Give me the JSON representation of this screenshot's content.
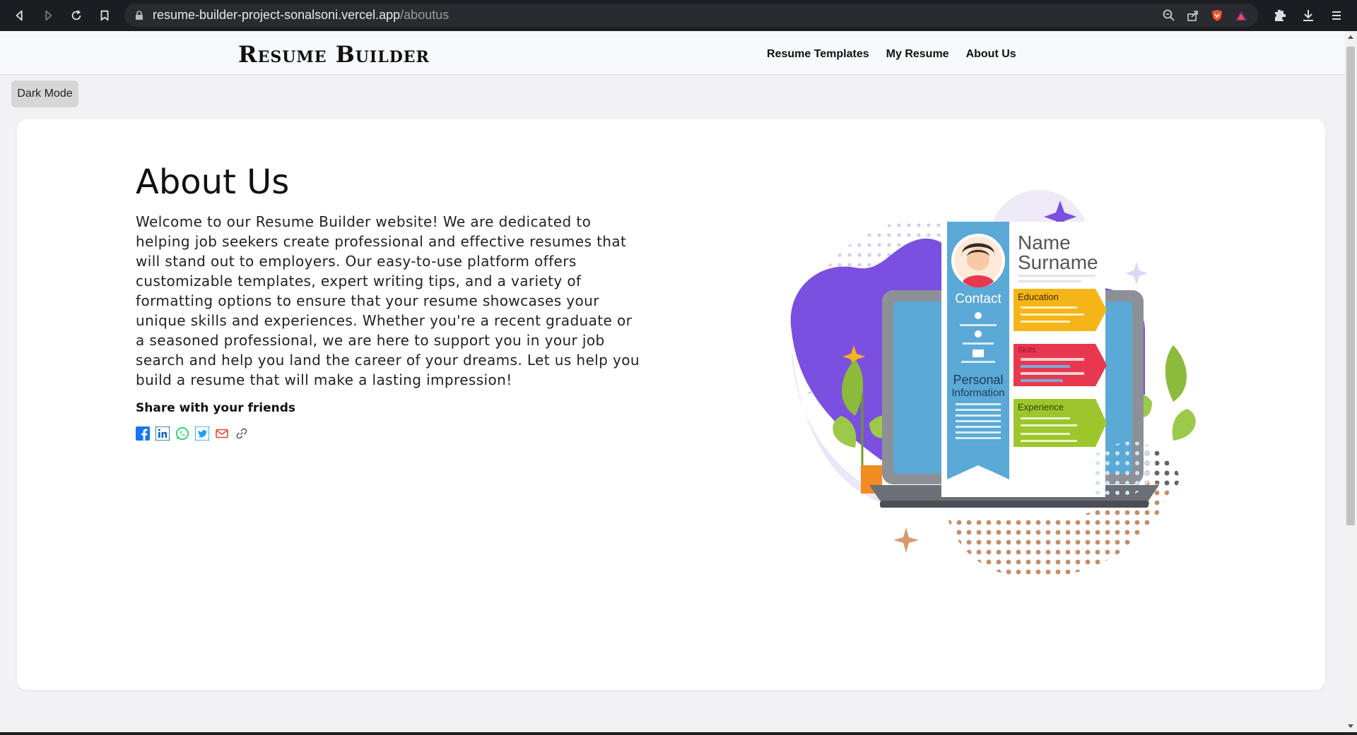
{
  "browser": {
    "url_domain": "resume-builder-project-sonalsoni.vercel.app",
    "url_path": "/aboutus"
  },
  "header": {
    "logo": "Resume Builder",
    "nav": [
      "Resume Templates",
      "My Resume",
      "About Us"
    ]
  },
  "dark_mode_label": "Dark Mode",
  "about": {
    "title": "About Us",
    "body": "Welcome to our Resume Builder website! We are dedicated to helping job seekers create professional and effective resumes that will stand out to employers. Our easy-to-use platform offers customizable templates, expert writing tips, and a variety of formatting options to ensure that your resume showcases your unique skills and experiences. Whether you're a recent graduate or a seasoned professional, we are here to support you in your job search and help you land the career of your dreams. Let us help you build a resume that will make a lasting impression!",
    "share_label": "Share with your friends"
  },
  "illustration": {
    "name": "Name",
    "surname": "Surname",
    "contact": "Contact",
    "personal_line1": "Personal",
    "personal_line2": "Information",
    "education": "Education",
    "skills": "Skills",
    "experience": "Experience"
  },
  "colors": {
    "purple": "#7b4fe0",
    "resume_blue": "#5aa9d6",
    "education_yellow": "#f5b518",
    "skills_red": "#e8384f",
    "experience_green": "#9dc62d"
  }
}
